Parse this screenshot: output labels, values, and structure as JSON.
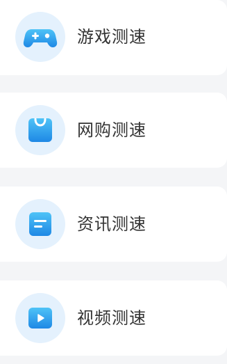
{
  "items": [
    {
      "label": "游戏测速",
      "icon": "gamepad-icon"
    },
    {
      "label": "网购测速",
      "icon": "shopping-bag-icon"
    },
    {
      "label": "资讯测速",
      "icon": "news-icon"
    },
    {
      "label": "视频测速",
      "icon": "video-play-icon"
    }
  ],
  "colors": {
    "page_background": "#f4f5f7",
    "card_background": "#ffffff",
    "icon_background": "#e4f1fd",
    "icon_blue_light": "#4fc3f7",
    "icon_blue_dark": "#1e88e5",
    "label_text": "#333333"
  }
}
